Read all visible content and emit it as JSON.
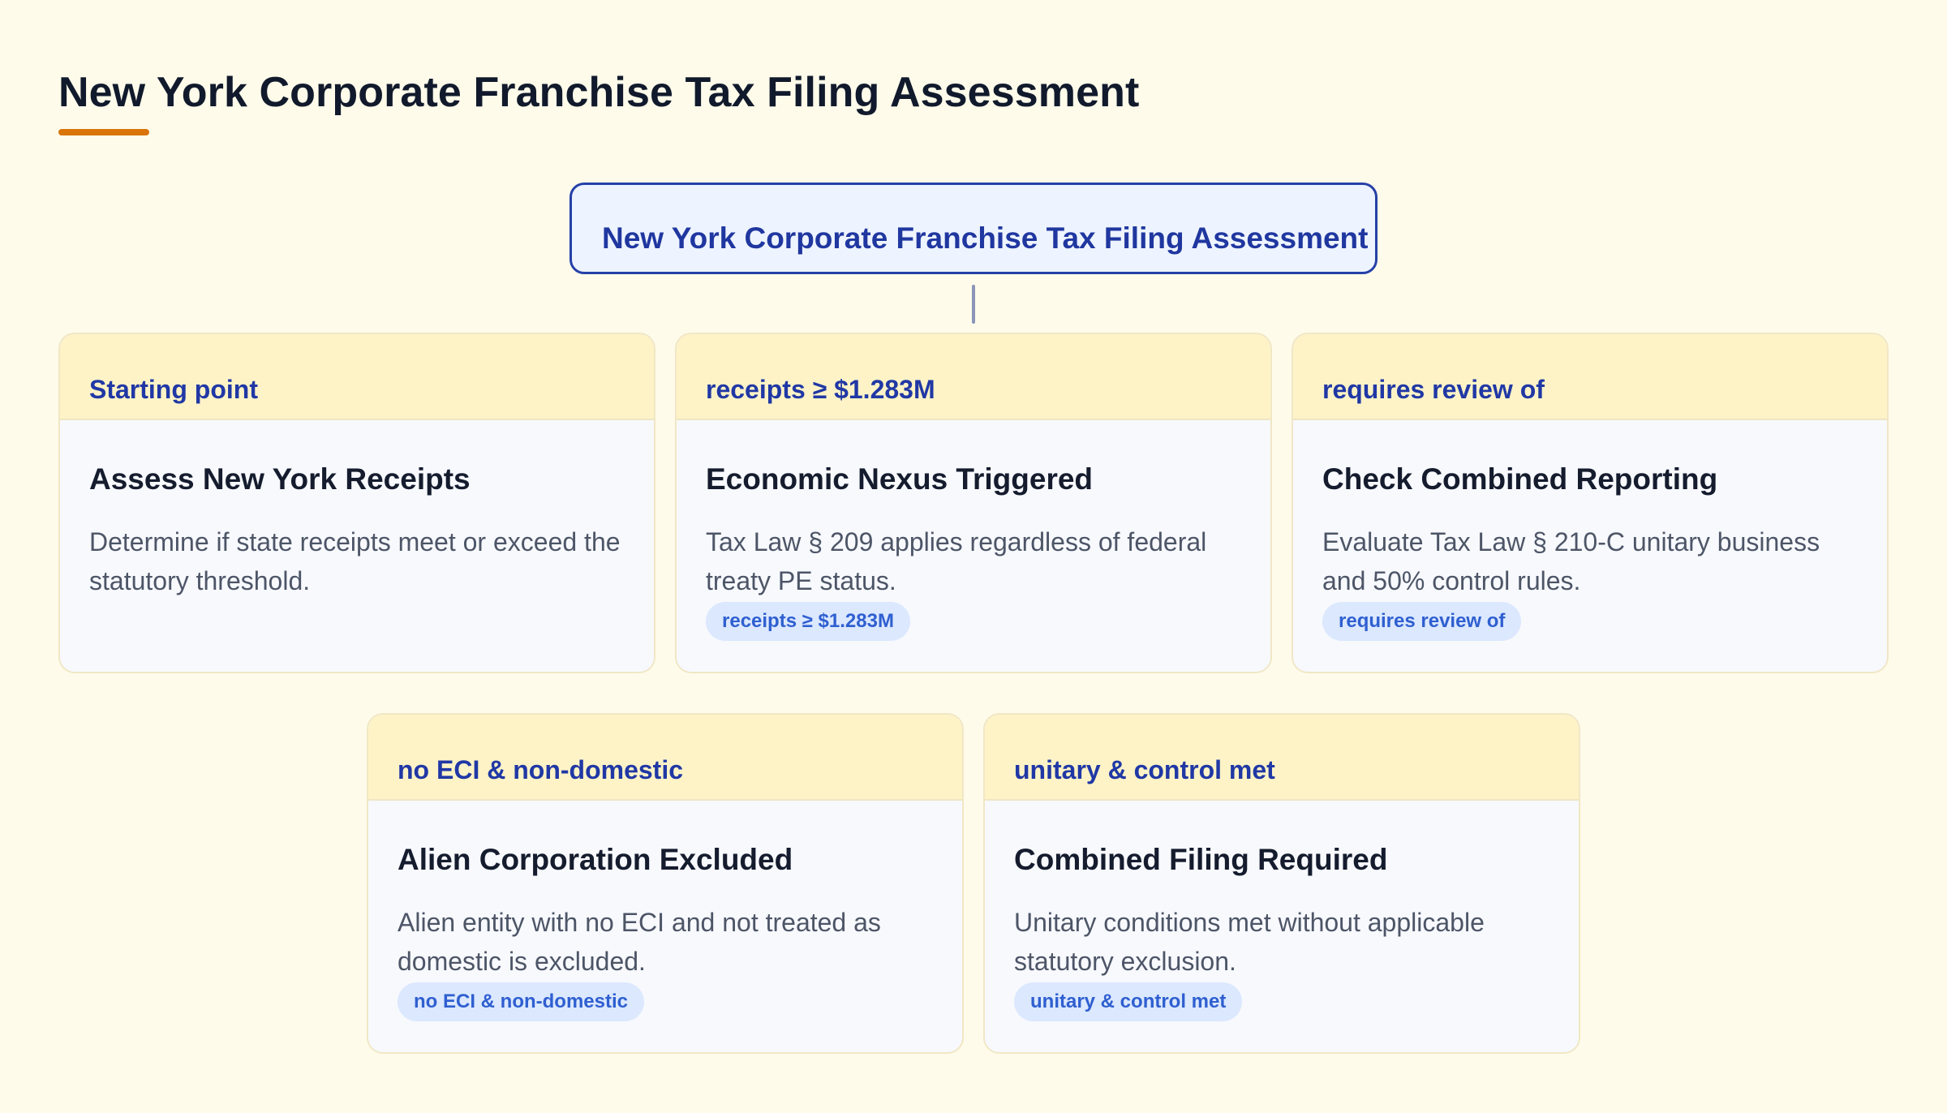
{
  "page": {
    "title": "New York Corporate Franchise Tax Filing Assessment"
  },
  "root": {
    "label": "New York Corporate Franchise Tax Filing Assessment"
  },
  "nodes": [
    {
      "header": "Starting point",
      "title": "Assess New York Receipts",
      "description": "Determine if state receipts meet or exceed the statutory threshold.",
      "badge": ""
    },
    {
      "header": "receipts ≥ $1.283M",
      "title": "Economic Nexus Triggered",
      "description": "Tax Law § 209 applies regardless of federal treaty PE status.",
      "badge": "receipts ≥ $1.283M"
    },
    {
      "header": "requires review of",
      "title": "Check Combined Reporting",
      "description": "Evaluate Tax Law § 210-C unitary business and 50% control rules.",
      "badge": "requires review of"
    },
    {
      "header": "no ECI & non-domestic",
      "title": "Alien Corporation Excluded",
      "description": "Alien entity with no ECI and not treated as domestic is excluded.",
      "badge": "no ECI & non-domestic"
    },
    {
      "header": "unitary & control met",
      "title": "Combined Filing Required",
      "description": "Unitary conditions met without applicable statutory exclusion.",
      "badge": "unitary & control met"
    }
  ],
  "colors": {
    "background": "#fefbea",
    "accent_underline": "#d97508",
    "root_border": "#2540a8",
    "card_header": "#fef3c7",
    "badge_bg": "#dbe8fe",
    "badge_text": "#2f5fd0"
  }
}
